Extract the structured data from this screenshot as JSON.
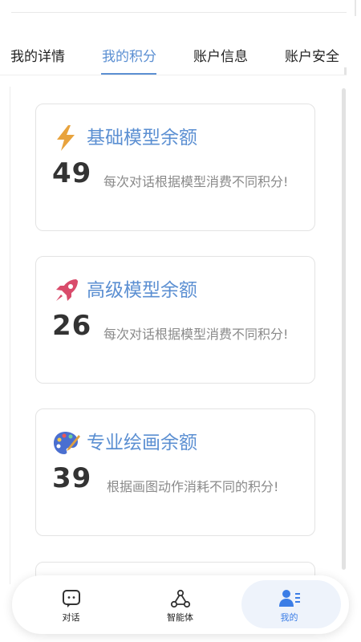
{
  "tabs": [
    {
      "label": "我的详情",
      "active": false
    },
    {
      "label": "我的积分",
      "active": true
    },
    {
      "label": "账户信息",
      "active": false
    },
    {
      "label": "账户安全",
      "active": false
    }
  ],
  "cards": [
    {
      "title": "基础模型余额",
      "value": "49",
      "desc": "每次对话根据模型消费不同积分!",
      "icon": "lightning-icon"
    },
    {
      "title": "高级模型余额",
      "value": "26",
      "desc": "每次对话根据模型消费不同积分!",
      "icon": "rocket-icon"
    },
    {
      "title": "专业绘画余额",
      "value": "39",
      "desc": "根据画图动作消耗不同的积分!",
      "icon": "palette-icon"
    }
  ],
  "nav": [
    {
      "label": "对话",
      "icon": "chat-icon",
      "active": false
    },
    {
      "label": "智能体",
      "icon": "agent-icon",
      "active": false
    },
    {
      "label": "我的",
      "icon": "user-profile-icon",
      "active": true
    }
  ],
  "colors": {
    "accent": "#5b8fd2",
    "nav_active": "#3b7de6"
  }
}
